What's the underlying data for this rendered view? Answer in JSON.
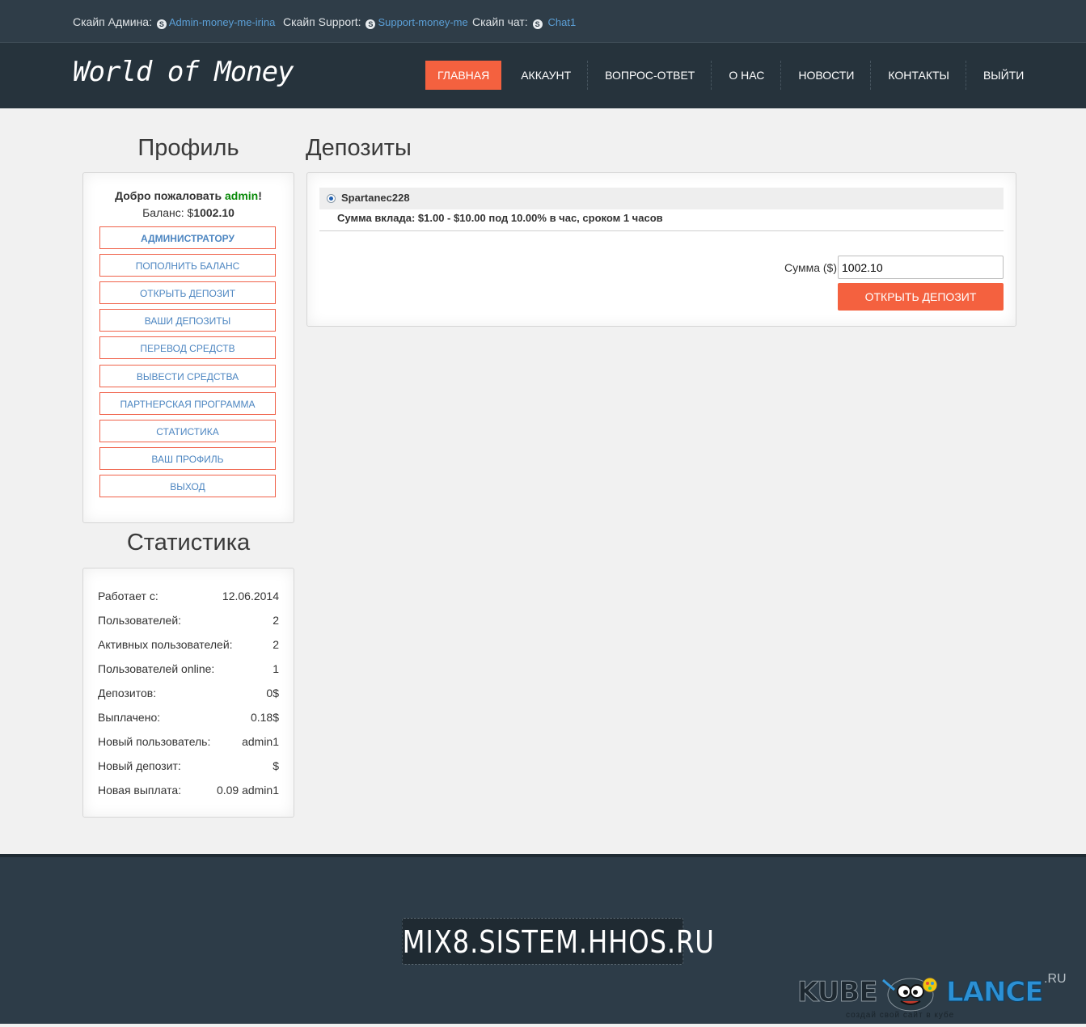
{
  "topbar": {
    "admin_label": "Скайп Админа:",
    "admin_link": "Admin-money-me-irina",
    "support_label": "Скайп Support:",
    "support_link": "Support-money-me",
    "chat_label": "Скайп чат:",
    "chat_link": "Chat1",
    "icon": "skype-icon"
  },
  "header": {
    "logo": "World of Money",
    "nav": [
      {
        "label": "ГЛАВНАЯ",
        "active": true
      },
      {
        "label": "АККАУНТ"
      },
      {
        "label": "ВОПРОС-ОТВЕТ"
      },
      {
        "label": "О НАС"
      },
      {
        "label": "НОВОСТИ"
      },
      {
        "label": "КОНТАКТЫ"
      },
      {
        "label": "ВЫЙТИ"
      }
    ],
    "accent_color": "#f4613f"
  },
  "profile": {
    "title": "Профиль",
    "welcome_prefix": "Добро пожаловать",
    "username": "admin",
    "welcome_suffix": "!",
    "balance_label": "Баланс: $",
    "balance_value": "1002.10",
    "menu": [
      "АДМИНИСТРАТОРУ",
      "ПОПОЛНИТЬ БАЛАНС",
      "ОТКРЫТЬ ДЕПОЗИТ",
      "ВАШИ ДЕПОЗИТЫ",
      "ПЕРЕВОД СРЕДСТВ",
      "ВЫВЕСТИ СРЕДСТВА",
      "ПАРТНЕРСКАЯ ПРОГРАММА",
      "СТАТИСТИКА",
      "ВАШ ПРОФИЛЬ",
      "ВЫХОД"
    ]
  },
  "stats": {
    "title": "Статистика",
    "rows": [
      {
        "k": "Работает с:",
        "v": "12.06.2014"
      },
      {
        "k": "Пользователей:",
        "v": "2"
      },
      {
        "k": "Активных пользователей:",
        "v": "2"
      },
      {
        "k": "Пользователей online:",
        "v": "1"
      },
      {
        "k": "Депозитов:",
        "v": "0$"
      },
      {
        "k": "Выплачено:",
        "v": "0.18$"
      },
      {
        "k": "Новый пользователь:",
        "v": "admin1"
      },
      {
        "k": "Новый депозит:",
        "v": "$"
      },
      {
        "k": "Новая выплата:",
        "v": "0.09 admin1"
      }
    ]
  },
  "deposits": {
    "title": "Депозиты",
    "plan_name": "Spartanec228",
    "plan_desc": "Сумма вклада: $1.00 - $10.00 под 10.00% в час, сроком 1 часов",
    "sum_label": "Сумма ($):",
    "sum_value": "1002.10",
    "open_button": "ОТКРЫТЬ ДЕПОЗИТ"
  },
  "footer": {
    "domain": "MIX8.SISTEM.HHOS.RU",
    "watermark_left": "KUBE",
    "watermark_right": "LANCE",
    "watermark_ru": ".RU",
    "watermark_tagline": "создай свой сайт в кубе"
  }
}
